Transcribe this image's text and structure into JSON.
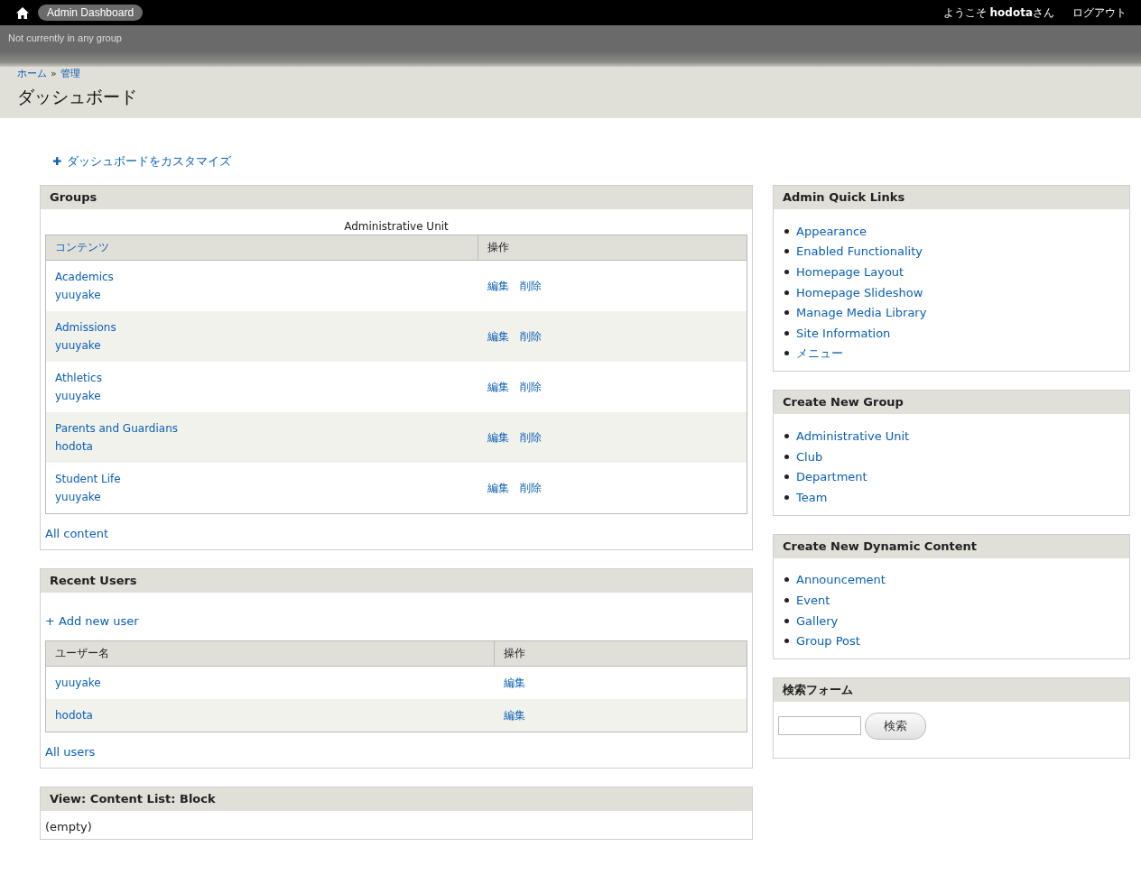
{
  "topbar": {
    "home_label": "Admin Dashboard",
    "welcome": "ようこそ **hodota**さん",
    "logout": "ログアウト"
  },
  "group_bar": {
    "text": "Not currently in any group"
  },
  "header": {
    "breadcrumb": [
      "ホーム",
      "管理"
    ],
    "separator": "»",
    "title": "ダッシュボード"
  },
  "customize": {
    "icon": "✚",
    "label": "ダッシュボードをカスタマイズ"
  },
  "groups": {
    "title": "Groups",
    "caption": "Administrative Unit",
    "columns": [
      "コンテンツ",
      "操作"
    ],
    "rows": [
      {
        "name": "Academics",
        "author": "yuuyake",
        "actions": [
          "編集",
          "削除"
        ]
      },
      {
        "name": "Admissions",
        "author": "yuuyake",
        "actions": [
          "編集",
          "削除"
        ]
      },
      {
        "name": "Athletics",
        "author": "yuuyake",
        "actions": [
          "編集",
          "削除"
        ]
      },
      {
        "name": "Parents and Guardians",
        "author": "hodota",
        "actions": [
          "編集",
          "削除"
        ]
      },
      {
        "name": "Student Life",
        "author": "yuuyake",
        "actions": [
          "編集",
          "削除"
        ]
      }
    ],
    "more_link": "All content"
  },
  "recent_users": {
    "title": "Recent Users",
    "add_link": "+ Add new user",
    "columns": [
      "ユーザー名",
      "操作"
    ],
    "rows": [
      {
        "name": "yuuyake",
        "action": "編集"
      },
      {
        "name": "hodota",
        "action": "編集"
      }
    ],
    "more_link": "All users"
  },
  "content_list": {
    "title": "View: Content List: Block",
    "text": "(empty)"
  },
  "sidebar": [
    {
      "kind": "links",
      "title": "Admin Quick Links",
      "items": [
        "Appearance",
        "Enabled Functionality",
        "Homepage Layout",
        "Homepage Slideshow",
        "Manage Media Library",
        "Site Information",
        "メニュー"
      ]
    },
    {
      "kind": "links",
      "title": "Create New Group",
      "items": [
        "Administrative Unit",
        "Club",
        "Department",
        "Team"
      ]
    },
    {
      "kind": "links",
      "title": "Create New Dynamic Content",
      "items": [
        "Announcement",
        "Event",
        "Gallery",
        "Group Post"
      ]
    },
    {
      "kind": "search",
      "title": "検索フォーム",
      "button": "検索"
    }
  ]
}
